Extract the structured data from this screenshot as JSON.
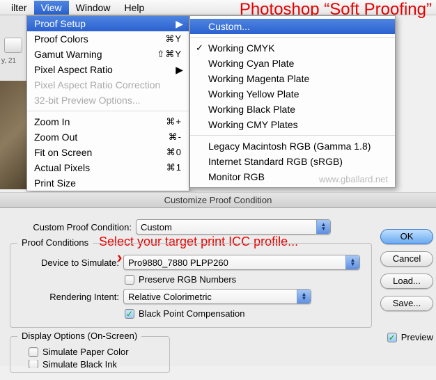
{
  "menubar": {
    "items": [
      "ilter",
      "View",
      "Window",
      "Help"
    ],
    "active_index": 1
  },
  "annotation": {
    "title": "Photoshop “Soft Proofing”",
    "select_profile": "Select your target print ICC profile..."
  },
  "menu": {
    "items": [
      {
        "label": "Proof Setup",
        "highlight": true,
        "submenu": true
      },
      {
        "label": "Proof Colors",
        "shortcut": "⌘Y"
      },
      {
        "label": "Gamut Warning",
        "shortcut": "⇧⌘Y"
      },
      {
        "label": "Pixel Aspect Ratio",
        "submenu": true
      },
      {
        "label": "Pixel Aspect Ratio Correction",
        "disabled": true
      },
      {
        "label": "32-bit Preview Options...",
        "disabled": true
      },
      {
        "sep": true
      },
      {
        "label": "Zoom In",
        "shortcut": "⌘+"
      },
      {
        "label": "Zoom Out",
        "shortcut": "⌘-"
      },
      {
        "label": "Fit on Screen",
        "shortcut": "⌘0"
      },
      {
        "label": "Actual Pixels",
        "shortcut": "⌘1"
      },
      {
        "label": "Print Size"
      }
    ]
  },
  "submenu": {
    "items": [
      {
        "label": "Custom...",
        "highlight": true
      },
      {
        "sep": true
      },
      {
        "label": "Working CMYK",
        "checked": true
      },
      {
        "label": "Working Cyan Plate"
      },
      {
        "label": "Working Magenta Plate"
      },
      {
        "label": "Working Yellow Plate"
      },
      {
        "label": "Working Black Plate"
      },
      {
        "label": "Working CMY Plates"
      },
      {
        "sep": true
      },
      {
        "label": "Legacy Macintosh RGB (Gamma 1.8)"
      },
      {
        "label": "Internet Standard RGB (sRGB)"
      },
      {
        "label": "Monitor RGB"
      }
    ],
    "watermark": "www.gballard.net"
  },
  "bg": {
    "tab_label": "y, 21"
  },
  "dialog": {
    "title": "Customize Proof Condition",
    "custom_proof_label": "Custom Proof Condition:",
    "custom_proof_value": "Custom",
    "group1_legend": "Proof Conditions",
    "device_label": "Device to Simulate:",
    "device_value": "Pro9880_7880 PLPP260",
    "preserve_rgb": "Preserve RGB Numbers",
    "rendering_label": "Rendering Intent:",
    "rendering_value": "Relative Colorimetric",
    "bpc": "Black Point Compensation",
    "group2_legend": "Display Options (On-Screen)",
    "sim_paper": "Simulate Paper Color",
    "sim_ink": "Simulate Black Ink",
    "buttons": {
      "ok": "OK",
      "cancel": "Cancel",
      "load": "Load...",
      "save": "Save..."
    },
    "preview": "Preview"
  }
}
